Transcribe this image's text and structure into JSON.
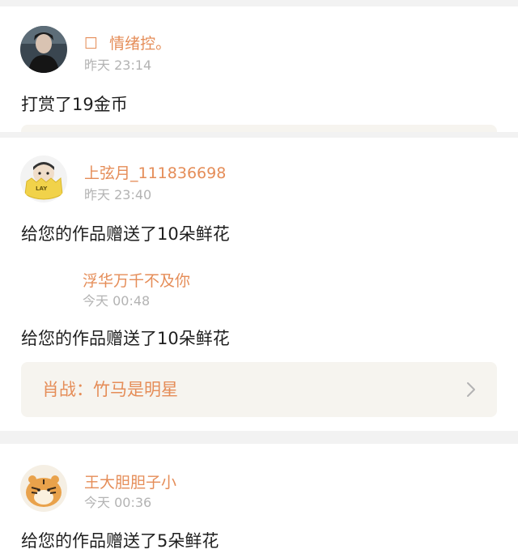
{
  "feed": [
    {
      "user_name": "情绪控。",
      "name_prefix_glyph": "☐",
      "time": "昨天 23:14",
      "message": "打赏了19金币",
      "avatar_icon": "avatar-dark-portrait-icon"
    },
    {
      "user_name": "上弦月_111836698",
      "time": "昨天 23:40",
      "message": "给您的作品赠送了10朵鲜花",
      "avatar_icon": "avatar-egg-character-icon",
      "avatar_badge": "LAY",
      "sub": {
        "user_name": "浮华万千不及你",
        "time": "今天 00:48",
        "message": "给您的作品赠送了10朵鲜花"
      },
      "work_title": "肖战：竹马是明星"
    },
    {
      "user_name": "王大胆胆子小",
      "time": "今天 00:36",
      "message": "给您的作品赠送了5朵鲜花",
      "avatar_icon": "avatar-tiger-icon"
    }
  ],
  "colors": {
    "name": "#e58d58",
    "time": "#b3b3b3",
    "text": "#1f1f1f",
    "card_bg": "#ffffff",
    "page_bg": "#f2f2f2",
    "work_bg": "#f6f4ef"
  }
}
